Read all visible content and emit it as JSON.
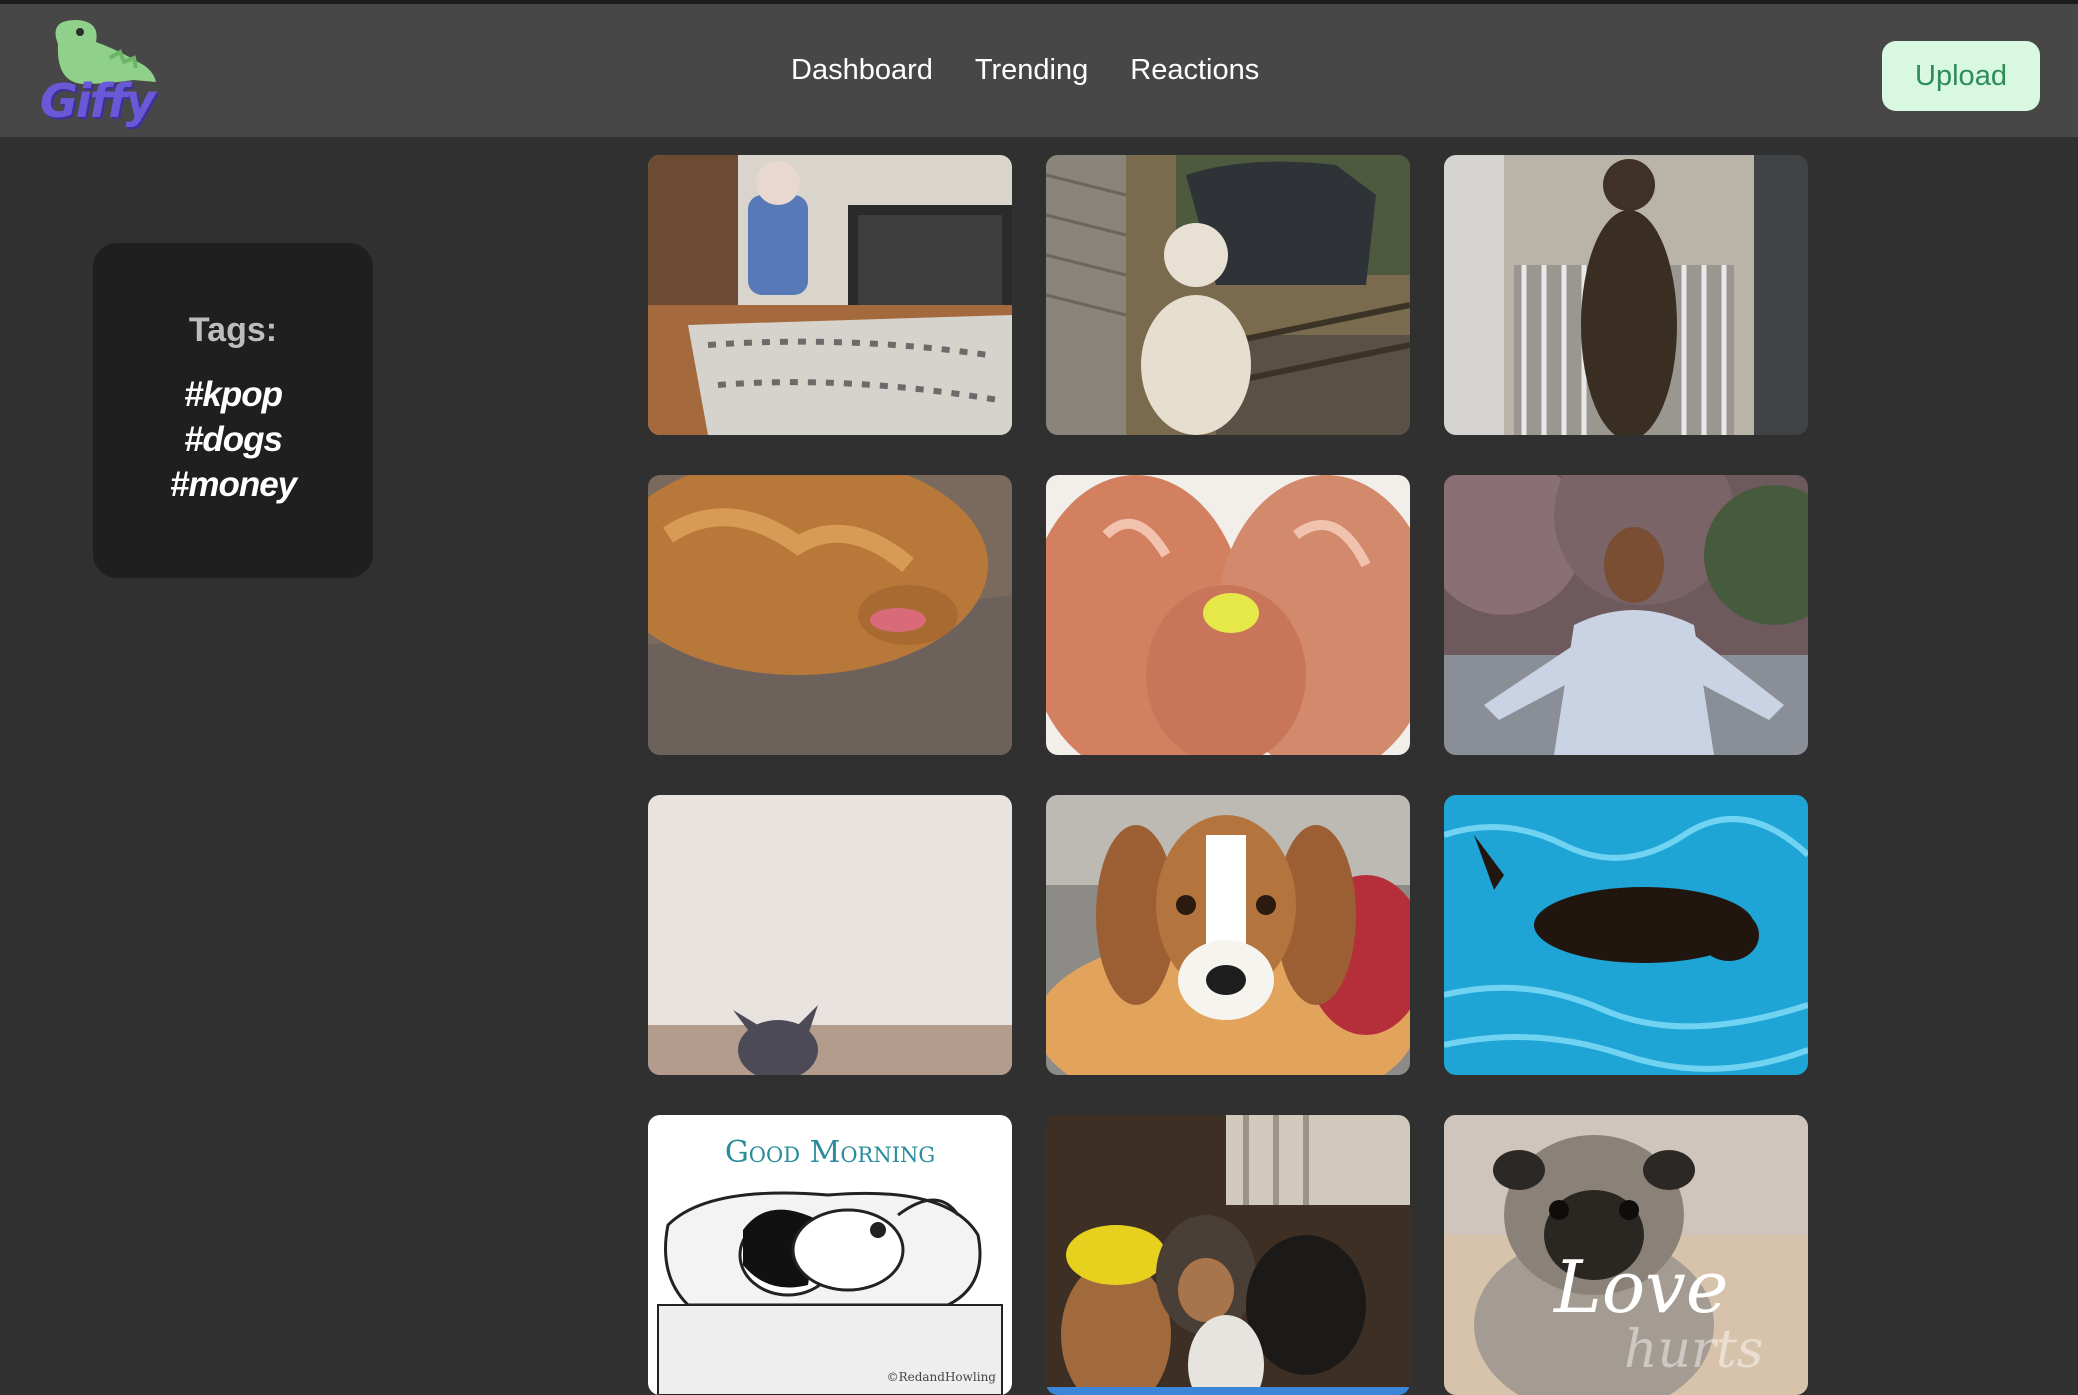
{
  "brand": {
    "name": "Giffy"
  },
  "nav": {
    "links": [
      "Dashboard",
      "Trending",
      "Reactions"
    ],
    "upload_label": "Upload"
  },
  "sidebar": {
    "title": "Tags:",
    "tags": [
      "#kpop",
      "#dogs",
      "#money"
    ]
  },
  "gifs": [
    {
      "subject": "dog in costume in living room"
    },
    {
      "subject": "yellow labrador on porch steps"
    },
    {
      "subject": "dog at gate by door"
    },
    {
      "subject": "golden retriever on couch"
    },
    {
      "subject": "two golden retrievers with ball"
    },
    {
      "subject": "man pointing outdoors"
    },
    {
      "subject": "dog jumping by ceiling"
    },
    {
      "subject": "beagle in blanket"
    },
    {
      "subject": "black dog swimming in pool"
    },
    {
      "subject": "good morning cartoon dog",
      "caption": "Good Morning",
      "credit": "©RedandHowling"
    },
    {
      "subject": "dogs in hoods and hard hat"
    },
    {
      "subject": "pug love hurts",
      "caption_line1": "Love",
      "caption_line2": "hurts"
    }
  ],
  "colors": {
    "page_bg": "#303030",
    "navbar_bg": "#474747",
    "card_bg": "#1f1f1f",
    "upload_bg": "#d8f8e2",
    "upload_text": "#2f8c57",
    "logo_purple": "#6a59d6",
    "logo_green": "#8fd18a"
  }
}
